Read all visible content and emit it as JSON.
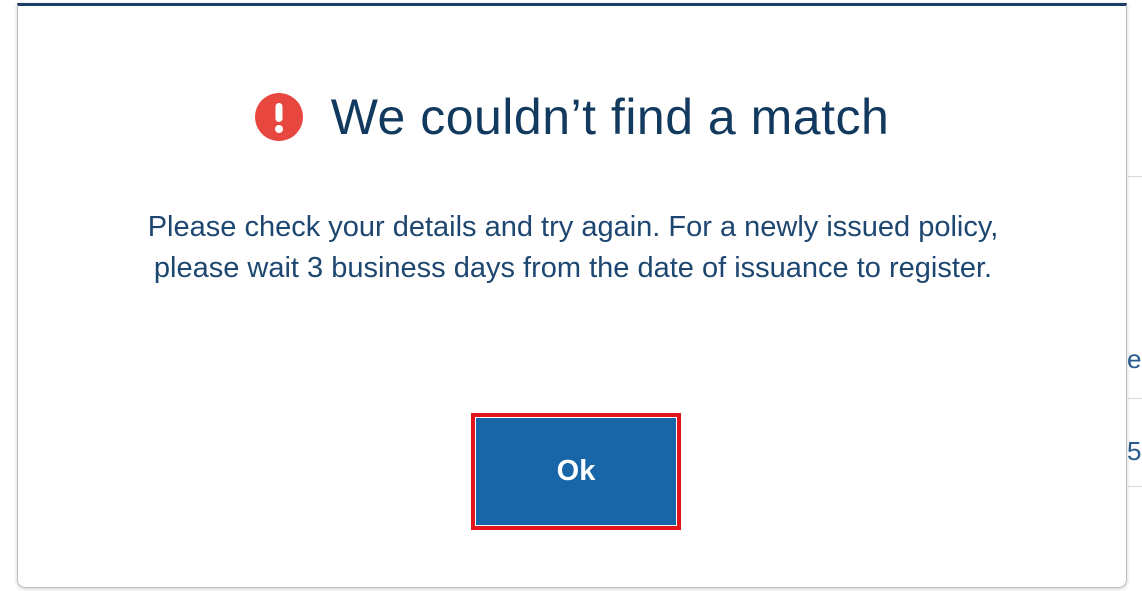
{
  "modal": {
    "title": "We couldn’t find a match",
    "title_icon": "exclamation-circle-icon",
    "message": "Please check your details and try again. For a newly issued policy, please wait 3 business days from the date of issuance to register.",
    "ok_button_label": "Ok"
  },
  "background": {
    "glyph_upper": "e",
    "glyph_lower": "5"
  },
  "colors": {
    "title": "#12395e",
    "message": "#1d4770",
    "alert_icon": "#e8473f",
    "button_bg": "#1866a8",
    "button_text": "#ffffff",
    "focus_outline": "#e3141c",
    "modal_top_border": "#1f3f66"
  }
}
